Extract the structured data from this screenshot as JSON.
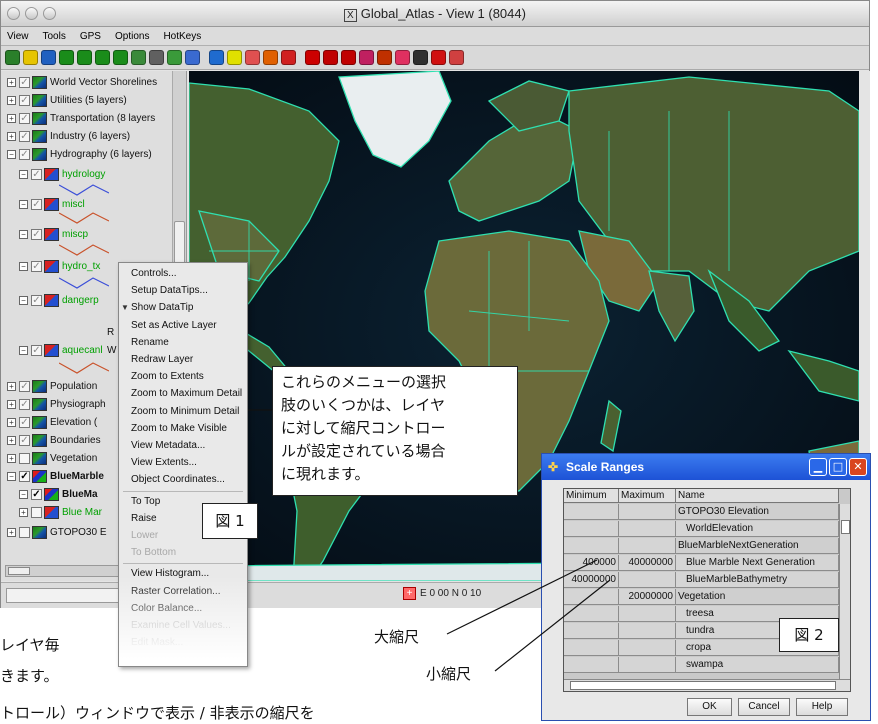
{
  "window": {
    "title": "Global_Atlas - View 1 (8044)",
    "menu": [
      "View",
      "Tools",
      "GPS",
      "Options",
      "HotKeys"
    ]
  },
  "toolbar": {
    "icons": [
      "globe-icon",
      "select-box-icon",
      "pan-icon",
      "binoculars-icon",
      "zoom-in-icon",
      "zoom-out-icon",
      "zoom-extent-icon",
      "zoom-box-icon",
      "gear-icon",
      "globe-color-icon",
      "layers-icon",
      "camera-icon",
      "number-icon",
      "chart-icon",
      "arrows-icon",
      "arrows-alt-icon",
      "no-entry-icon",
      "target-icon",
      "magnify-icon",
      "pointer-icon",
      "edit-icon",
      "grid-icon",
      "bars-icon",
      "cursor-icon",
      "paint-icon"
    ],
    "colors": [
      "#2a7f2a",
      "#e6c400",
      "#2060c0",
      "#1a8c1a",
      "#1a8c1a",
      "#1a8c1a",
      "#1a8c1a",
      "#3a8a3a",
      "#606060",
      "#3a9a3a",
      "#3a6ad0",
      "#1f6bcf",
      "#e0e000",
      "#e05050",
      "#e06000",
      "#d02020",
      "#cc0000",
      "#c00000",
      "#c00000",
      "#c02060",
      "#c03000",
      "#e03060",
      "#303030",
      "#d01010",
      "#d04040"
    ]
  },
  "tree": {
    "rows": [
      {
        "expander": "⊞",
        "label": "World Vector Shorelines",
        "checked": true,
        "style": "normal"
      },
      {
        "expander": "⊞",
        "label": "Utilities  (5 layers)",
        "checked": true,
        "style": "normal"
      },
      {
        "expander": "⊞",
        "label": "Transportation  (8 layers",
        "checked": true,
        "style": "normal"
      },
      {
        "expander": "⊞",
        "label": "Industry  (6 layers)",
        "checked": true,
        "style": "normal"
      },
      {
        "expander": "⊟",
        "label": "Hydrography  (6 layers)",
        "checked": true,
        "style": "normal"
      },
      {
        "expander": "⊟",
        "label": "hydrology",
        "checked": true,
        "style": "green"
      },
      {
        "expander": "⊟",
        "label": "miscl",
        "checked": true,
        "style": "green"
      },
      {
        "expander": "⊟",
        "label": "miscp",
        "checked": true,
        "style": "green"
      },
      {
        "expander": "⊟",
        "label": "hydro_tx",
        "checked": true,
        "style": "green"
      },
      {
        "expander": "⊟",
        "label": "dangerp",
        "checked": true,
        "style": "green"
      },
      {
        "expander": "⊟",
        "label": "aquecanl",
        "checked": true,
        "style": "green"
      },
      {
        "expander": "⊞",
        "label": "Population",
        "checked": true,
        "style": "normal"
      },
      {
        "expander": "⊞",
        "label": "Physiograph",
        "checked": true,
        "style": "normal"
      },
      {
        "expander": "⊞",
        "label": "Elevation  (",
        "checked": true,
        "style": "normal"
      },
      {
        "expander": "⊞",
        "label": "Boundaries",
        "checked": true,
        "style": "normal"
      },
      {
        "expander": "⊞",
        "label": "Vegetation",
        "checked": false,
        "style": "normal"
      },
      {
        "expander": "⊟",
        "label": "BlueMarble",
        "checked": true,
        "style": "bold"
      },
      {
        "expander": "⊟",
        "label": "BlueMa",
        "checked": true,
        "style": "bold"
      },
      {
        "expander": "⊞",
        "label": "Blue Mar",
        "checked": false,
        "style": "green"
      },
      {
        "expander": "⊞",
        "label": "GTOPO30 E",
        "checked": false,
        "style": "normal"
      }
    ],
    "dangerp_sublabels": [
      "R",
      "W"
    ]
  },
  "context_menu": {
    "items": [
      {
        "label": "Controls...",
        "disabled": false
      },
      {
        "label": "Setup DataTips...",
        "disabled": false
      },
      {
        "label": "Show DataTip",
        "disabled": false,
        "checked": true
      },
      {
        "label": "Set as Active Layer",
        "disabled": false
      },
      {
        "label": "Rename",
        "disabled": false
      },
      {
        "label": "Redraw Layer",
        "disabled": false
      },
      {
        "label": "Zoom to Extents",
        "disabled": false
      },
      {
        "label": "Zoom to Maximum Detail",
        "disabled": false
      },
      {
        "label": "Zoom to Minimum Detail",
        "disabled": false
      },
      {
        "label": "Zoom to Make Visible",
        "disabled": false
      },
      {
        "label": "View Metadata...",
        "disabled": false
      },
      {
        "label": "View Extents...",
        "disabled": false
      },
      {
        "label": "Object Coordinates...",
        "disabled": false
      },
      {
        "label": "To Top",
        "disabled": false
      },
      {
        "label": "Raise",
        "disabled": false
      },
      {
        "label": "Lower",
        "disabled": true
      },
      {
        "label": "To Bottom",
        "disabled": true
      },
      {
        "label": "View Histogram...",
        "disabled": false
      },
      {
        "label": "Raster Correlation...",
        "disabled": false
      },
      {
        "label": "Color Balance...",
        "disabled": false
      },
      {
        "label": "Examine Cell Values...",
        "disabled": true
      },
      {
        "label": "Edit Mask...",
        "disabled": true
      }
    ]
  },
  "status": {
    "coordinate": "E 0 00  N 0 10"
  },
  "callout": {
    "lines": [
      "これらのメニューの選択",
      "肢のいくつかは、レイヤ",
      "に対して縮尺コントロー",
      "ルが設定されている場合",
      "に現れます。"
    ],
    "fig1": "図 1",
    "fig2": "図 2"
  },
  "scale_dialog": {
    "title": "Scale Ranges",
    "columns": [
      "Minimum",
      "Maximum",
      "Name"
    ],
    "rows": [
      {
        "min": "",
        "max": "",
        "name": "GTOPO30 Elevation",
        "indent": false
      },
      {
        "min": "",
        "max": "",
        "name": "WorldElevation",
        "indent": true
      },
      {
        "min": "",
        "max": "",
        "name": "BlueMarbleNextGeneration",
        "indent": false
      },
      {
        "min": "400000",
        "max": "40000000",
        "name": "Blue Marble Next Generation",
        "indent": true
      },
      {
        "min": "40000000",
        "max": "",
        "name": "BlueMarbleBathymetry",
        "indent": true
      },
      {
        "min": "",
        "max": "20000000",
        "name": "Vegetation",
        "indent": false
      },
      {
        "min": "",
        "max": "",
        "name": "treesa",
        "indent": true
      },
      {
        "min": "",
        "max": "",
        "name": "tundra",
        "indent": true
      },
      {
        "min": "",
        "max": "",
        "name": "cropa",
        "indent": true
      },
      {
        "min": "",
        "max": "",
        "name": "swampa",
        "indent": true
      }
    ],
    "buttons": {
      "ok": "OK",
      "cancel": "Cancel",
      "help": "Help"
    }
  },
  "annotations": {
    "large_scale": "大縮尺",
    "small_scale": "小縮尺",
    "overflow_line1": "レイヤ毎",
    "overflow_line2": "きます。",
    "overflow_line3": "トロール）ウィンドウで表示 / 非表示の縮尺を"
  },
  "colors": {
    "map_border": "#2fe0b0",
    "land": "#3f5a2f",
    "ocean": "#06121c",
    "dialog_title": "#1d52d6"
  }
}
